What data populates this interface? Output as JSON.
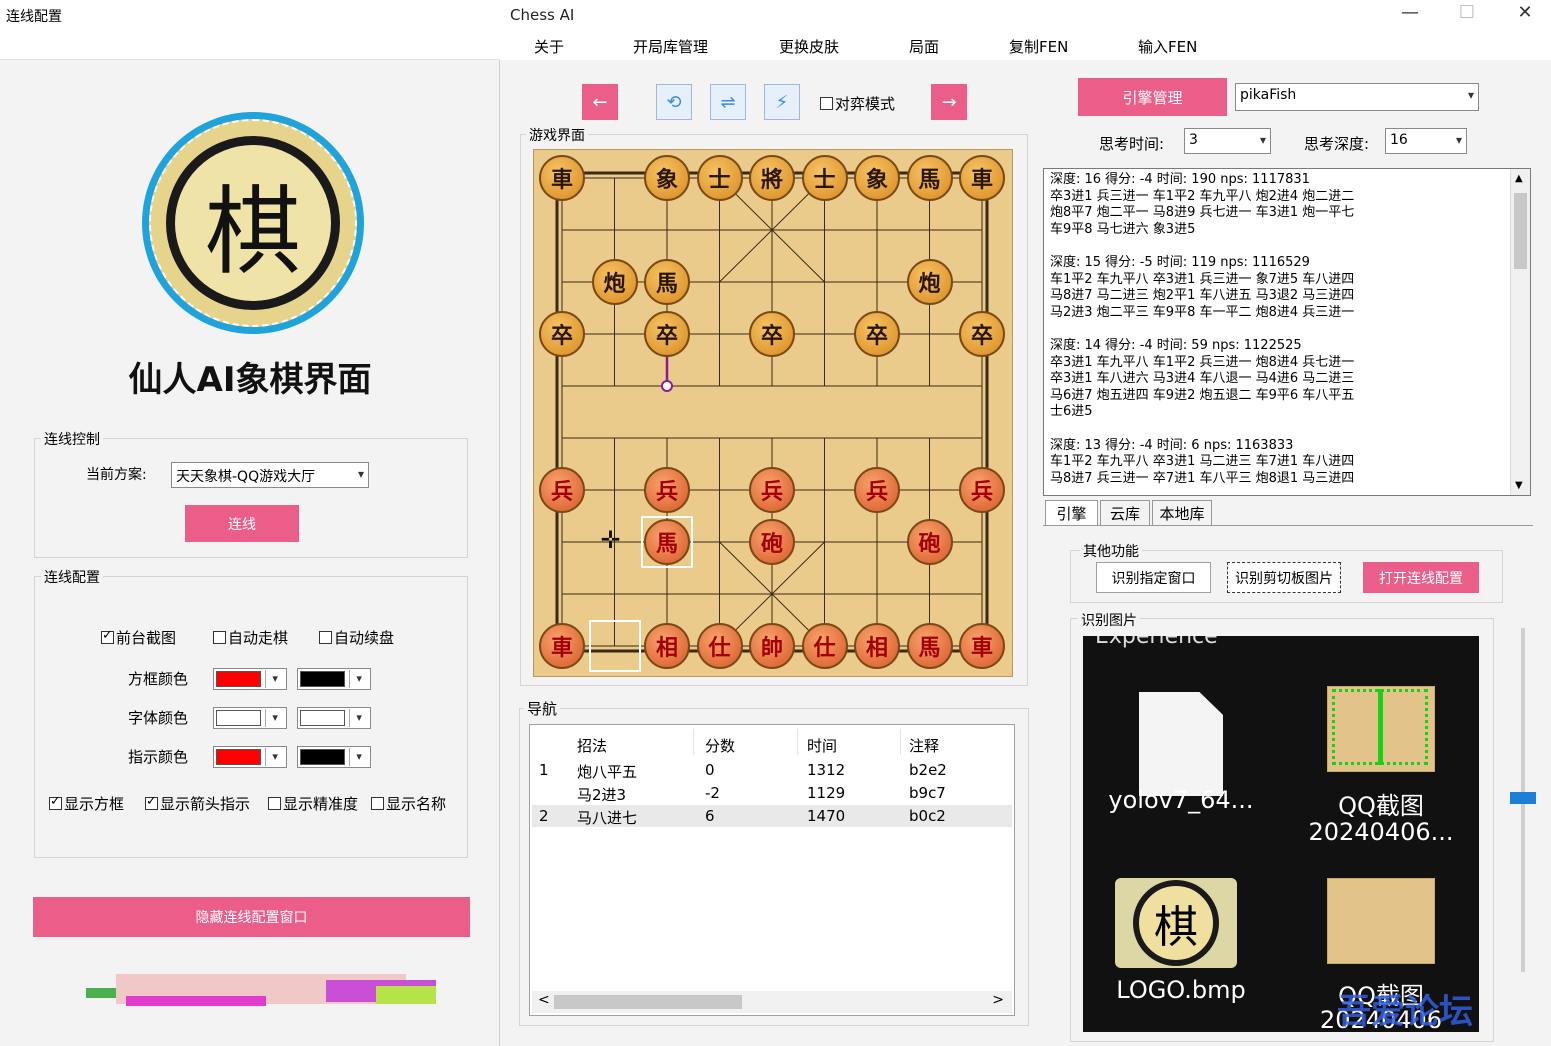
{
  "left": {
    "title": "连线配置",
    "logo_char": "棋",
    "app_name": "仙人AI象棋界面",
    "control_group": {
      "label": "连线控制",
      "scheme_label": "当前方案:",
      "scheme_value": "天天象棋-QQ游戏大厅",
      "connect_button": "连线"
    },
    "config_group": {
      "label": "连线配置",
      "checks_row1": [
        {
          "label": "前台截图",
          "checked": true
        },
        {
          "label": "自动走棋",
          "checked": false
        },
        {
          "label": "自动续盘",
          "checked": false
        }
      ],
      "color_rows": [
        {
          "label": "方框颜色",
          "c1": "#ff0000",
          "c2": "#000000"
        },
        {
          "label": "字体颜色",
          "c1": "#ffffff",
          "c2": "#ffffff"
        },
        {
          "label": "指示颜色",
          "c1": "#ff0000",
          "c2": "#000000"
        }
      ],
      "checks_row2": [
        {
          "label": "显示方框",
          "checked": true
        },
        {
          "label": "显示箭头指示",
          "checked": true
        },
        {
          "label": "显示精准度",
          "checked": false
        },
        {
          "label": "显示名称",
          "checked": false
        }
      ]
    },
    "hide_button": "隐藏连线配置窗口"
  },
  "right": {
    "title": "Chess AI",
    "win_controls": {
      "minimize": "—",
      "maximize": "☐",
      "close": "✕"
    },
    "menu": [
      "关于",
      "开局库管理",
      "更换皮肤",
      "局面",
      "复制FEN",
      "输入FEN"
    ],
    "toolbar": {
      "prev": "←",
      "next": "→",
      "game_mode": "对弈模式",
      "game_mode_checked": false
    },
    "board_label": "游戏界面",
    "board": {
      "black": [
        {
          "c": 0,
          "r": 0,
          "t": "車"
        },
        {
          "c": 2,
          "r": 0,
          "t": "象"
        },
        {
          "c": 3,
          "r": 0,
          "t": "士"
        },
        {
          "c": 4,
          "r": 0,
          "t": "將"
        },
        {
          "c": 5,
          "r": 0,
          "t": "士"
        },
        {
          "c": 6,
          "r": 0,
          "t": "象"
        },
        {
          "c": 7,
          "r": 0,
          "t": "馬"
        },
        {
          "c": 8,
          "r": 0,
          "t": "車"
        },
        {
          "c": 1,
          "r": 2,
          "t": "炮"
        },
        {
          "c": 2,
          "r": 2,
          "t": "馬"
        },
        {
          "c": 7,
          "r": 2,
          "t": "炮"
        },
        {
          "c": 0,
          "r": 3,
          "t": "卒"
        },
        {
          "c": 2,
          "r": 3,
          "t": "卒"
        },
        {
          "c": 4,
          "r": 3,
          "t": "卒"
        },
        {
          "c": 6,
          "r": 3,
          "t": "卒"
        },
        {
          "c": 8,
          "r": 3,
          "t": "卒"
        }
      ],
      "red": [
        {
          "c": 0,
          "r": 6,
          "t": "兵"
        },
        {
          "c": 2,
          "r": 6,
          "t": "兵"
        },
        {
          "c": 4,
          "r": 6,
          "t": "兵"
        },
        {
          "c": 6,
          "r": 6,
          "t": "兵"
        },
        {
          "c": 8,
          "r": 6,
          "t": "兵"
        },
        {
          "c": 2,
          "r": 7,
          "t": "馬"
        },
        {
          "c": 4,
          "r": 7,
          "t": "砲"
        },
        {
          "c": 7,
          "r": 7,
          "t": "砲"
        },
        {
          "c": 0,
          "r": 9,
          "t": "車"
        },
        {
          "c": 2,
          "r": 9,
          "t": "相"
        },
        {
          "c": 3,
          "r": 9,
          "t": "仕"
        },
        {
          "c": 4,
          "r": 9,
          "t": "帥"
        },
        {
          "c": 5,
          "r": 9,
          "t": "仕"
        },
        {
          "c": 6,
          "r": 9,
          "t": "相"
        },
        {
          "c": 7,
          "r": 9,
          "t": "馬"
        },
        {
          "c": 8,
          "r": 9,
          "t": "車"
        }
      ],
      "arrow": {
        "from_c": 2,
        "from_r": 3,
        "to_c": 2,
        "to_r": 4
      }
    },
    "engine": {
      "manage_button": "引擎管理",
      "engine_name": "pikaFish",
      "think_time_label": "思考时间:",
      "think_time": "3",
      "think_depth_label": "思考深度:",
      "think_depth": "16",
      "output": "深度: 16 得分: -4 时间: 190 nps: 1117831\n卒3进1 兵三进一 车1平2 车九平八 炮2进4 炮二进二\n炮8平7 炮二平一 马8进9 兵七进一 车3进1 炮一平七\n车9平8 马七进六 象3进5\n\n深度: 15 得分: -5 时间: 119 nps: 1116529\n车1平2 车九平八 卒3进1 兵三进一 象7进5 车八进四\n马8进7 马二进三 炮2平1 车八进五 马3退2 马三进四\n马2进3 炮二平三 车9平8 车一平二 炮8进4 兵三进一\n\n深度: 14 得分: -4 时间: 59 nps: 1122525\n卒3进1 车九平八 车1平2 兵三进一 炮8进4 兵七进一\n卒3进1 车八进六 马3进4 车八退一 马4进6 马二进三\n马6进7 炮五进四 车9进2 炮五退二 车9平6 车八平五\n士6进5\n\n深度: 13 得分: -4 时间: 6 nps: 1163833\n车1平2 车九平八 卒3进1 马二进三 车7进1 车八进四\n马8进7 兵三进一 卒7进1 车八平三 炮8退1 马三进四",
      "tabs": [
        "引擎",
        "云库",
        "本地库"
      ]
    },
    "other": {
      "label": "其他功能",
      "btn1": "识别指定窗口",
      "btn2": "识别剪切板图片",
      "btn3": "打开连线配置"
    },
    "image_panel": {
      "label": "识别图片",
      "top_text": "Experience",
      "files": [
        "yolov7_64...",
        "QQ截图",
        "20240406...",
        "LOGO.bmp",
        "QQ截图",
        "20240406"
      ],
      "watermark": "吾爱论坛"
    },
    "nav": {
      "label": "导航",
      "headers": [
        "招法",
        "分数",
        "时间",
        "注释"
      ],
      "rows": [
        {
          "n": "1",
          "move": "炮八平五",
          "score": "0",
          "time": "1312",
          "note": "b2e2"
        },
        {
          "n": "",
          "move": "马2进3",
          "score": "-2",
          "time": "1129",
          "note": "b9c7"
        },
        {
          "n": "2",
          "move": "马八进七",
          "score": "6",
          "time": "1470",
          "note": "b0c2"
        }
      ],
      "scroll_left": "<",
      "scroll_right": ">"
    }
  },
  "colors": {
    "accent": "#ec5e8a",
    "blue": "#3a8de0"
  }
}
